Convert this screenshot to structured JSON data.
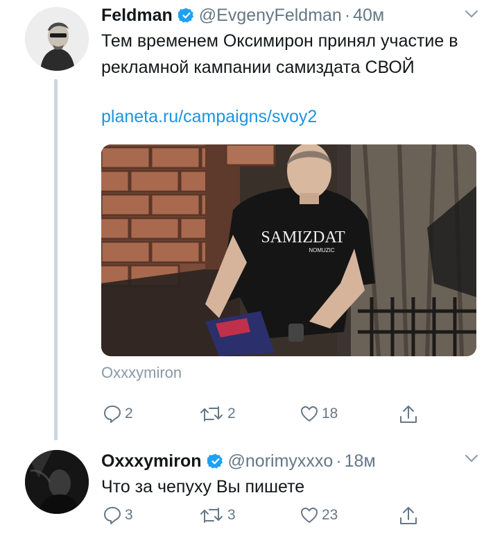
{
  "tweets": [
    {
      "author_name": "Feldman",
      "author_handle": "@EvgenyFeldman",
      "separator": "·",
      "time": "40м",
      "verified": true,
      "text": "Тем временем Оксимирон принял участие в рекламной кампании самиздата СВОЙ",
      "link": "planeta.ru/campaigns/svoy2",
      "media_credit": "Oxxxymiron",
      "shirt_text": "SAMIZDAT",
      "shirt_subtext": "NOMUZIC",
      "replies": "2",
      "retweets": "2",
      "likes": "18"
    },
    {
      "author_name": "Oxxxymiron",
      "author_handle": "@norimyxxxo",
      "separator": "·",
      "time": "18м",
      "verified": true,
      "text": "Что за чепуху Вы пишете",
      "replies": "3",
      "retweets": "3",
      "likes": "23"
    }
  ],
  "colors": {
    "verified_badge": "#1da1f2",
    "link": "#1b95e0",
    "secondary_text": "#657786",
    "thread_line": "#ccd6dd"
  },
  "icons": [
    "verified-icon",
    "chevron-down-icon",
    "reply-icon",
    "retweet-icon",
    "like-icon",
    "share-icon"
  ]
}
